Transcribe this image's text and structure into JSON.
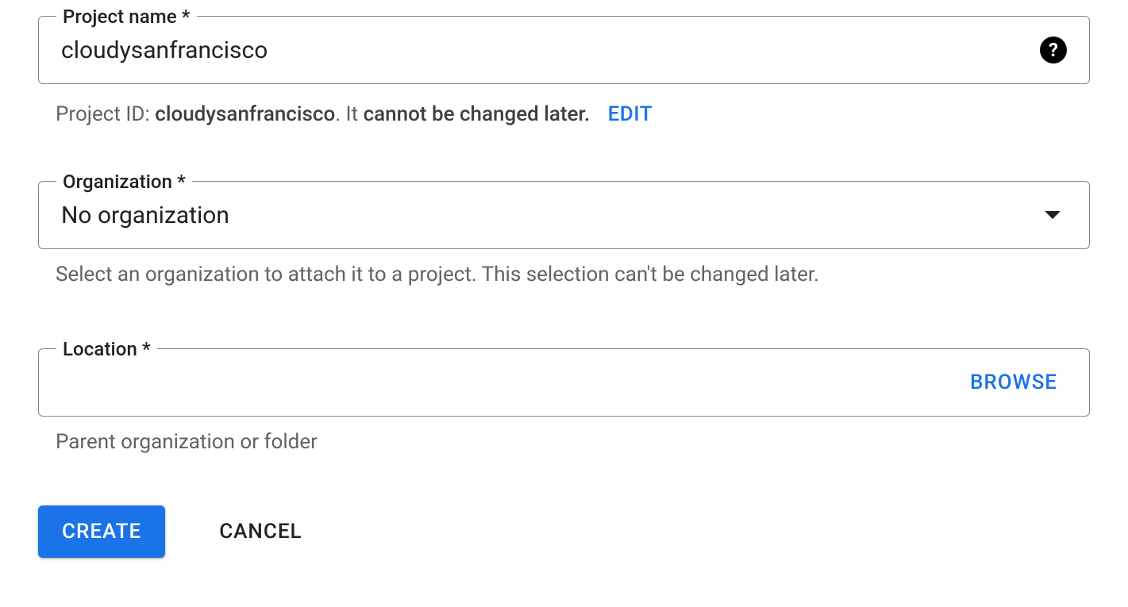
{
  "projectName": {
    "label": "Project name *",
    "value": "cloudysanfrancisco",
    "helperPrefix": "Project ID: ",
    "helperId": "cloudysanfrancisco",
    "helperMid": ". It ",
    "helperBold": "cannot be changed later.",
    "editLabel": "EDIT"
  },
  "organization": {
    "label": "Organization *",
    "value": "No organization",
    "helper": "Select an organization to attach it to a project. This selection can't be changed later."
  },
  "location": {
    "label": "Location *",
    "value": "",
    "browseLabel": "BROWSE",
    "helper": "Parent organization or folder"
  },
  "buttons": {
    "create": "CREATE",
    "cancel": "CANCEL"
  }
}
